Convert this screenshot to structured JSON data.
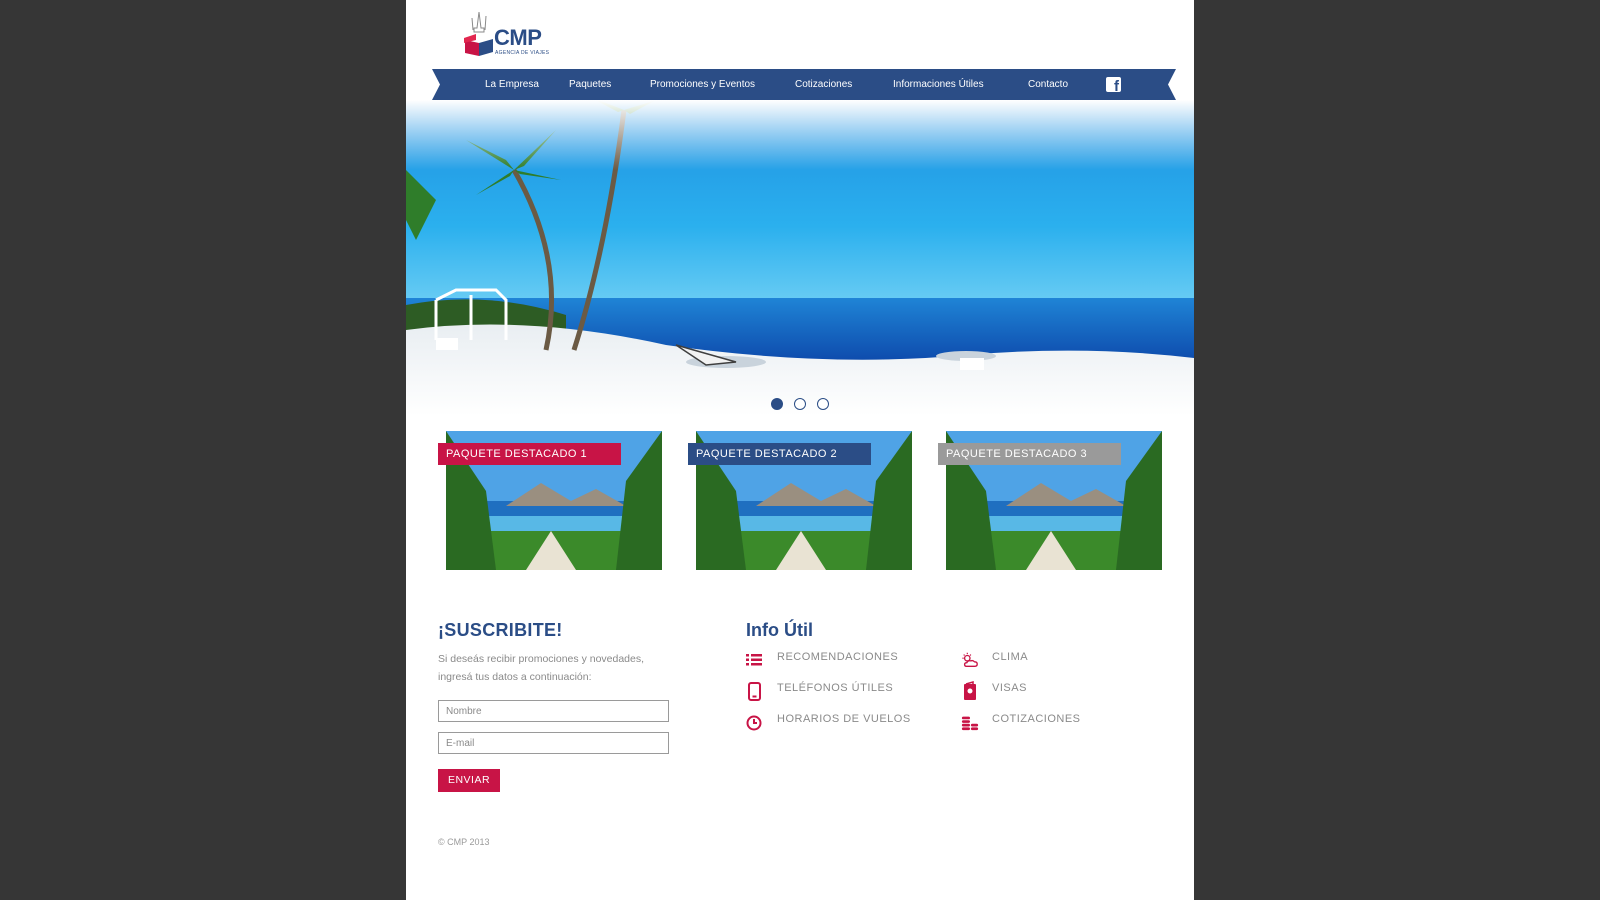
{
  "brand": {
    "name": "CMP",
    "tagline": "AGENCIA DE VIAJES"
  },
  "nav": {
    "items": [
      {
        "label": "La Empresa"
      },
      {
        "label": "Paquetes"
      },
      {
        "label": "Promociones y Eventos"
      },
      {
        "label": "Cotizaciones"
      },
      {
        "label": "Informaciones Útiles"
      },
      {
        "label": "Contacto"
      }
    ],
    "facebook_icon": "facebook-icon"
  },
  "hero": {
    "slides": 3,
    "active_slide": 1
  },
  "featured": [
    {
      "label": "PAQUETE DESTACADO 1",
      "color": "#c81446"
    },
    {
      "label": "PAQUETE DESTACADO 2",
      "color": "#2b4d86"
    },
    {
      "label": "PAQUETE DESTACADO 3",
      "color": "#9a9a9a"
    }
  ],
  "subscribe": {
    "title": "¡SUSCRIBITE!",
    "description": "Si deseás recibir promociones y novedades, ingresá tus datos a continuación:",
    "name_placeholder": "Nombre",
    "email_placeholder": "E-mail",
    "button_label": "ENVIAR"
  },
  "info": {
    "title": "Info Útil",
    "items": [
      {
        "label": "RECOMENDACIONES",
        "icon": "list-icon"
      },
      {
        "label": "CLIMA",
        "icon": "weather-icon"
      },
      {
        "label": "TELÉFONOS ÚTILES",
        "icon": "phone-icon"
      },
      {
        "label": "VISAS",
        "icon": "passport-icon"
      },
      {
        "label": "HORARIOS DE VUELOS",
        "icon": "clock-icon"
      },
      {
        "label": "COTIZACIONES",
        "icon": "coins-icon"
      }
    ]
  },
  "footer": {
    "copyright": "© CMP 2013"
  },
  "colors": {
    "primary": "#2b4d86",
    "accent": "#c81446",
    "muted": "#9a9a9a",
    "background": "#363636"
  }
}
